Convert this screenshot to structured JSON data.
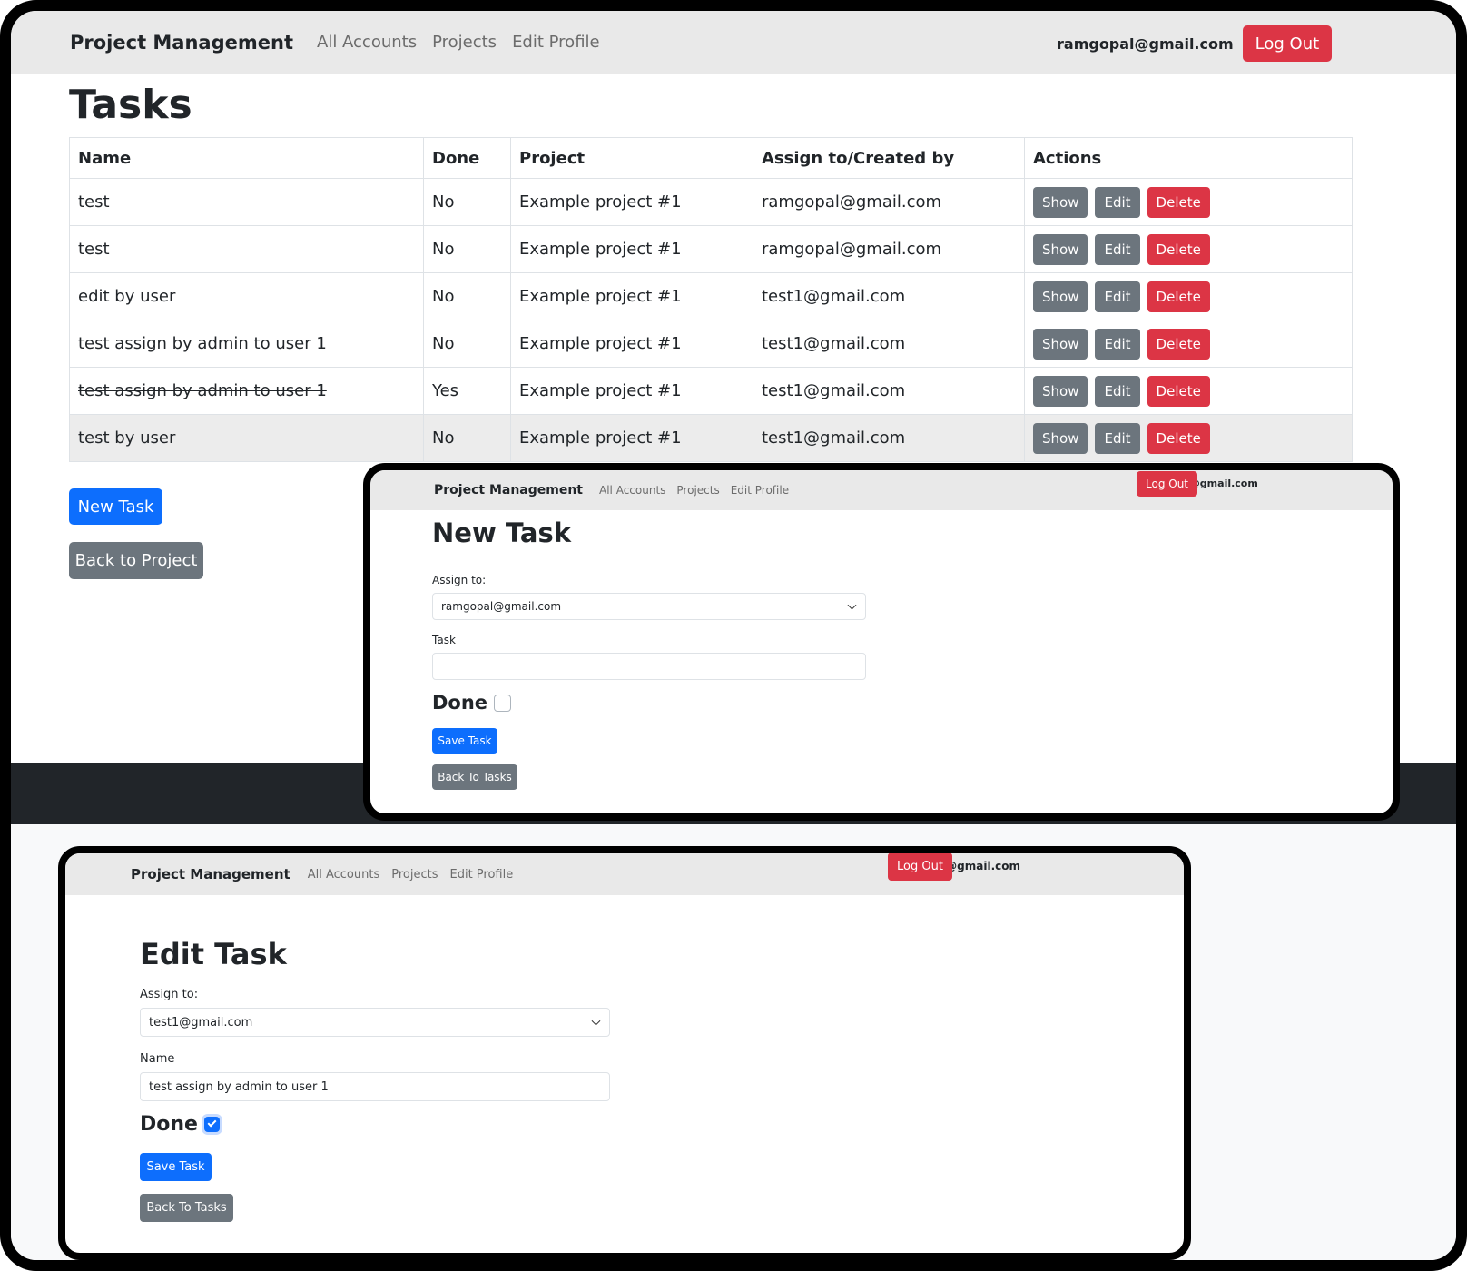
{
  "main": {
    "navbar": {
      "brand": "Project Management",
      "links": [
        "All Accounts",
        "Projects",
        "Edit Profile"
      ],
      "user_email": "ramgopal@gmail.com",
      "logout_label": "Log Out"
    },
    "title": "Tasks",
    "table": {
      "headers": [
        "Name",
        "Done",
        "Project",
        "Assign to/Created by",
        "Actions"
      ],
      "rows": [
        {
          "name": "test",
          "done": "No",
          "project": "Example project #1",
          "assignee": "ramgopal@gmail.com"
        },
        {
          "name": "test",
          "done": "No",
          "project": "Example project #1",
          "assignee": "ramgopal@gmail.com"
        },
        {
          "name": "edit by user",
          "done": "No",
          "project": "Example project #1",
          "assignee": "test1@gmail.com"
        },
        {
          "name": "test assign by admin to user 1",
          "done": "No",
          "project": "Example project #1",
          "assignee": "test1@gmail.com"
        },
        {
          "name": "test assign by admin to user 1",
          "done": "Yes",
          "project": "Example project #1",
          "assignee": "test1@gmail.com"
        },
        {
          "name": "test by user",
          "done": "No",
          "project": "Example project #1",
          "assignee": "test1@gmail.com"
        }
      ],
      "action_labels": {
        "show": "Show",
        "edit": "Edit",
        "delete": "Delete"
      }
    },
    "new_task_label": "New Task",
    "back_to_project_label": "Back to Project"
  },
  "new_task_panel": {
    "navbar": {
      "brand": "Project Management",
      "links": [
        "All Accounts",
        "Projects",
        "Edit Profile"
      ],
      "user_email": "ramgopal@gmail.com",
      "logout_label": "Log Out"
    },
    "title": "New Task",
    "assign_label": "Assign to:",
    "assign_value": "ramgopal@gmail.com",
    "task_label": "Task",
    "task_value": "",
    "done_label": "Done",
    "done_checked": false,
    "save_label": "Save Task",
    "back_label": "Back To Tasks"
  },
  "edit_task_panel": {
    "navbar": {
      "brand": "Project Management",
      "links": [
        "All Accounts",
        "Projects",
        "Edit Profile"
      ],
      "user_email": "ramgopal@gmail.com",
      "logout_label": "Log Out"
    },
    "title": "Edit Task",
    "assign_label": "Assign to:",
    "assign_value": "test1@gmail.com",
    "name_label": "Name",
    "name_value": "test assign by admin to user 1",
    "done_label": "Done",
    "done_checked": true,
    "save_label": "Save Task",
    "back_label": "Back To Tasks"
  },
  "colors": {
    "primary": "#0d6efd",
    "danger": "#dc3545",
    "secondary": "#6c757d",
    "navbar_bg": "#e9e9e9"
  },
  "icons": {
    "select_chevron": "chevron-down-icon",
    "checkbox_check": "check-icon"
  }
}
